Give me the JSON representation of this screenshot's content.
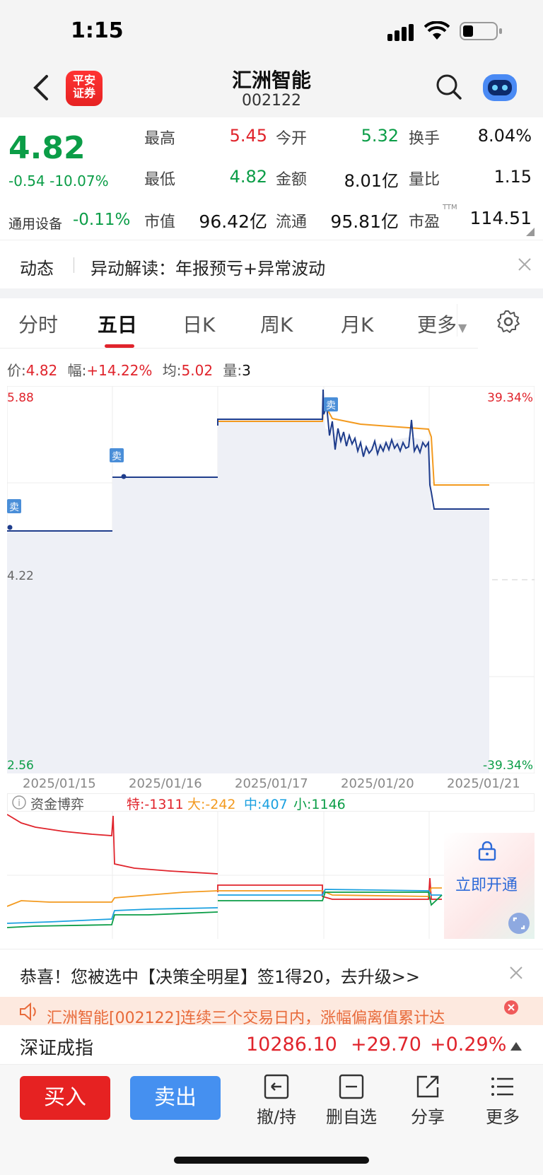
{
  "status": {
    "time": "1:15"
  },
  "header": {
    "logo_text": "平安\n证券",
    "name": "汇洲智能",
    "code": "002122"
  },
  "quote": {
    "price": "4.82",
    "change": "-0.54",
    "change_pct": "-10.07%",
    "sector": "通用设备",
    "sector_pct": "-0.11%",
    "fields": [
      {
        "label": "最高",
        "value": "5.45"
      },
      {
        "label": "今开",
        "value": "5.32"
      },
      {
        "label": "换手",
        "value": "8.04%"
      },
      {
        "label": "最低",
        "value": "4.82"
      },
      {
        "label": "金额",
        "value": "8.01亿"
      },
      {
        "label": "量比",
        "value": "1.15"
      },
      {
        "label": "市值",
        "value": "96.42亿"
      },
      {
        "label": "流通",
        "value": "95.81亿"
      },
      {
        "label": "市盈",
        "value": "114.51"
      }
    ],
    "pe_sup": "TTM"
  },
  "news": {
    "tag": "动态",
    "text": "异动解读：年报预亏+异常波动"
  },
  "tabs": [
    "分时",
    "五日",
    "日K",
    "周K",
    "月K",
    "更多"
  ],
  "info": {
    "price_label": "价:",
    "price": "4.82",
    "range_label": "幅:",
    "range": "+14.22%",
    "avg_label": "均:",
    "avg": "5.02",
    "vol_label": "量:",
    "vol": "3"
  },
  "chart_data": {
    "type": "line",
    "x": [
      "2025/01/15",
      "2025/01/16",
      "2025/01/17",
      "2025/01/20",
      "2025/01/21"
    ],
    "y_labels": {
      "top": "5.88",
      "mid": "4.22",
      "bottom": "2.56"
    },
    "pct_labels": {
      "top": "39.34%",
      "bottom": "-39.34%"
    },
    "series": [
      {
        "values": [
          4.78,
          5.3,
          5.65,
          5.2,
          4.82
        ]
      },
      {
        "values": [
          4.78,
          5.3,
          5.66,
          5.38,
          5.02
        ]
      }
    ],
    "markers": [
      "卖",
      "卖",
      "卖"
    ],
    "colors": {
      "price": "#1f3d8c",
      "avg": "#f39a1f",
      "fill": "#eef0f6"
    }
  },
  "fund": {
    "title": "资金博弈",
    "te": "特:-1311",
    "da": "大:-242",
    "zhong": "中:407",
    "xiao": "小:1146",
    "unlock": "立即开通"
  },
  "promo": {
    "text": "恭喜！您被选中【决策全明星】签1得20，去升级>>"
  },
  "marquee": {
    "text": "汇洲智能[002122]连续三个交易日内，涨幅偏离值累计达"
  },
  "index": {
    "name": "深证成指",
    "value": "10286.10",
    "change": "+29.70",
    "pct": "+0.29%"
  },
  "bottom": {
    "buy": "买入",
    "sell": "卖出",
    "tools": [
      "撤/持",
      "删自选",
      "分享",
      "更多"
    ]
  }
}
